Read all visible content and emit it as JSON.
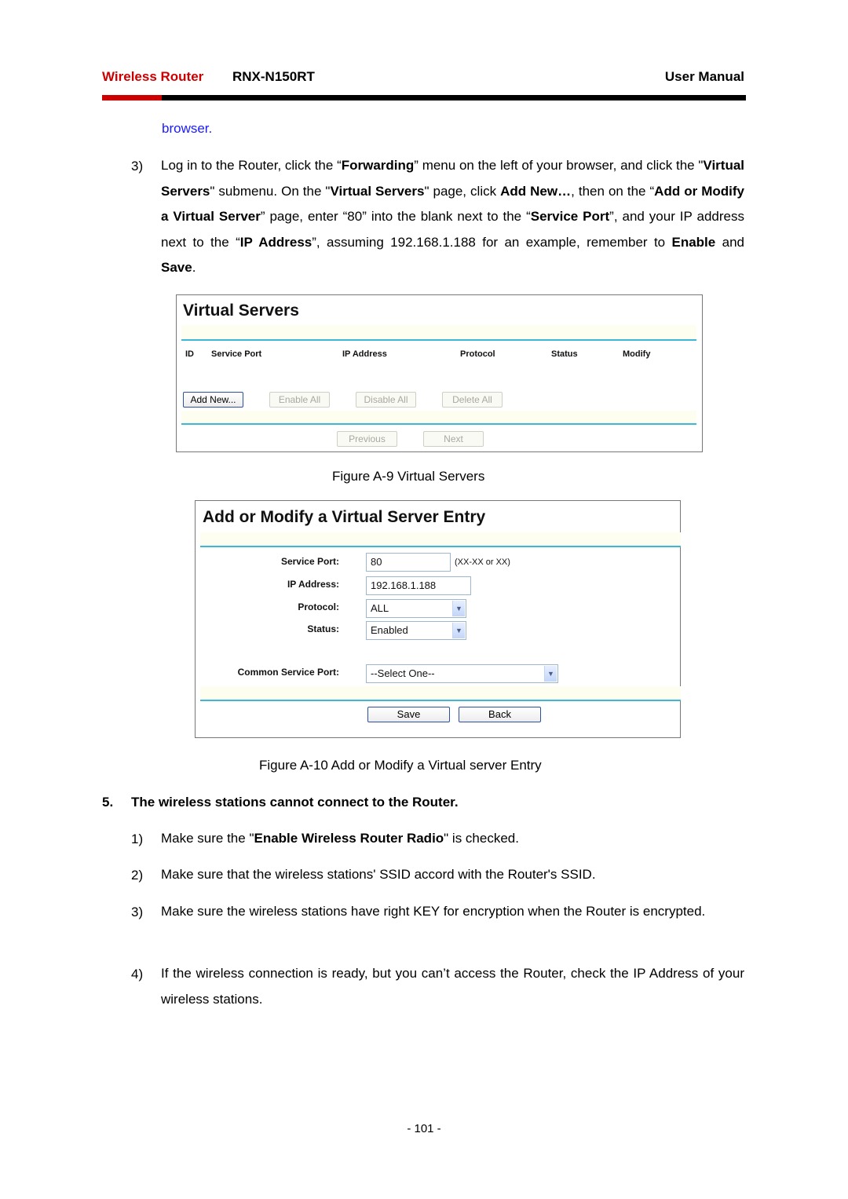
{
  "header": {
    "brand": "Wireless Router",
    "model": "RNX-N150RT",
    "doc_type": "User Manual",
    "brand_color": "#cc0000"
  },
  "continued_text": "browser.",
  "step3": {
    "number": "3)",
    "segments": [
      {
        "t": "Log in to the Router, click the “",
        "b": false
      },
      {
        "t": "Forwarding",
        "b": true
      },
      {
        "t": "” menu on the left of your browser, and click the \"",
        "b": false
      },
      {
        "t": "Virtual Servers",
        "b": true
      },
      {
        "t": "\" submenu. On the \"",
        "b": false
      },
      {
        "t": "Virtual Servers",
        "b": true
      },
      {
        "t": "\" page, click ",
        "b": false
      },
      {
        "t": "Add New…",
        "b": true
      },
      {
        "t": ", then on the “",
        "b": false
      },
      {
        "t": "Add or Modify a Virtual Server",
        "b": true
      },
      {
        "t": "” page, enter “80” into the blank next to the “",
        "b": false
      },
      {
        "t": "Service Port",
        "b": true
      },
      {
        "t": "”, and your IP address next to the “",
        "b": false
      },
      {
        "t": "IP Address",
        "b": true
      },
      {
        "t": "”, assuming 192.168.1.188 for an example, remember to ",
        "b": false
      },
      {
        "t": "Enable",
        "b": true
      },
      {
        "t": " and ",
        "b": false
      },
      {
        "t": "Save",
        "b": true
      },
      {
        "t": ".",
        "b": false
      }
    ]
  },
  "figure_a9": {
    "title": "Virtual Servers",
    "columns": [
      "ID",
      "Service Port",
      "IP Address",
      "Protocol",
      "Status",
      "Modify"
    ],
    "buttons": {
      "add_new": "Add New...",
      "enable_all": "Enable All",
      "disable_all": "Disable All",
      "delete_all": "Delete All",
      "previous": "Previous",
      "next": "Next"
    },
    "caption": "Figure A-9    Virtual Servers"
  },
  "figure_a10": {
    "title": "Add or Modify a Virtual Server Entry",
    "fields": {
      "service_port_label": "Service Port:",
      "service_port_value": "80",
      "service_port_hint": "(XX-XX or XX)",
      "ip_address_label": "IP Address:",
      "ip_address_value": "192.168.1.188",
      "protocol_label": "Protocol:",
      "protocol_value": "ALL",
      "status_label": "Status:",
      "status_value": "Enabled",
      "common_port_label": "Common Service Port:",
      "common_port_value": "--Select One--"
    },
    "buttons": {
      "save": "Save",
      "back": "Back"
    },
    "caption": "Figure A-10    Add or Modify a Virtual server Entry"
  },
  "section5": {
    "number": "5.",
    "title": "The wireless stations cannot connect to the Router.",
    "items": [
      {
        "num": "1)",
        "segments": [
          {
            "t": "Make sure the \"",
            "b": false
          },
          {
            "t": "Enable Wireless Router Radio",
            "b": true
          },
          {
            "t": "\" is checked.",
            "b": false
          }
        ]
      },
      {
        "num": "2)",
        "segments": [
          {
            "t": "Make sure that the wireless stations' SSID accord with the Router's SSID.",
            "b": false
          }
        ]
      },
      {
        "num": "3)",
        "segments": [
          {
            "t": "Make sure the wireless stations have right KEY for encryption when the Router is encrypted.",
            "b": false
          }
        ]
      },
      {
        "num": "4)",
        "segments": [
          {
            "t": "If the wireless connection is ready, but you can’t access the Router, check the IP Address of your wireless stations.",
            "b": false
          }
        ]
      }
    ]
  },
  "page_number": "- 101 -"
}
